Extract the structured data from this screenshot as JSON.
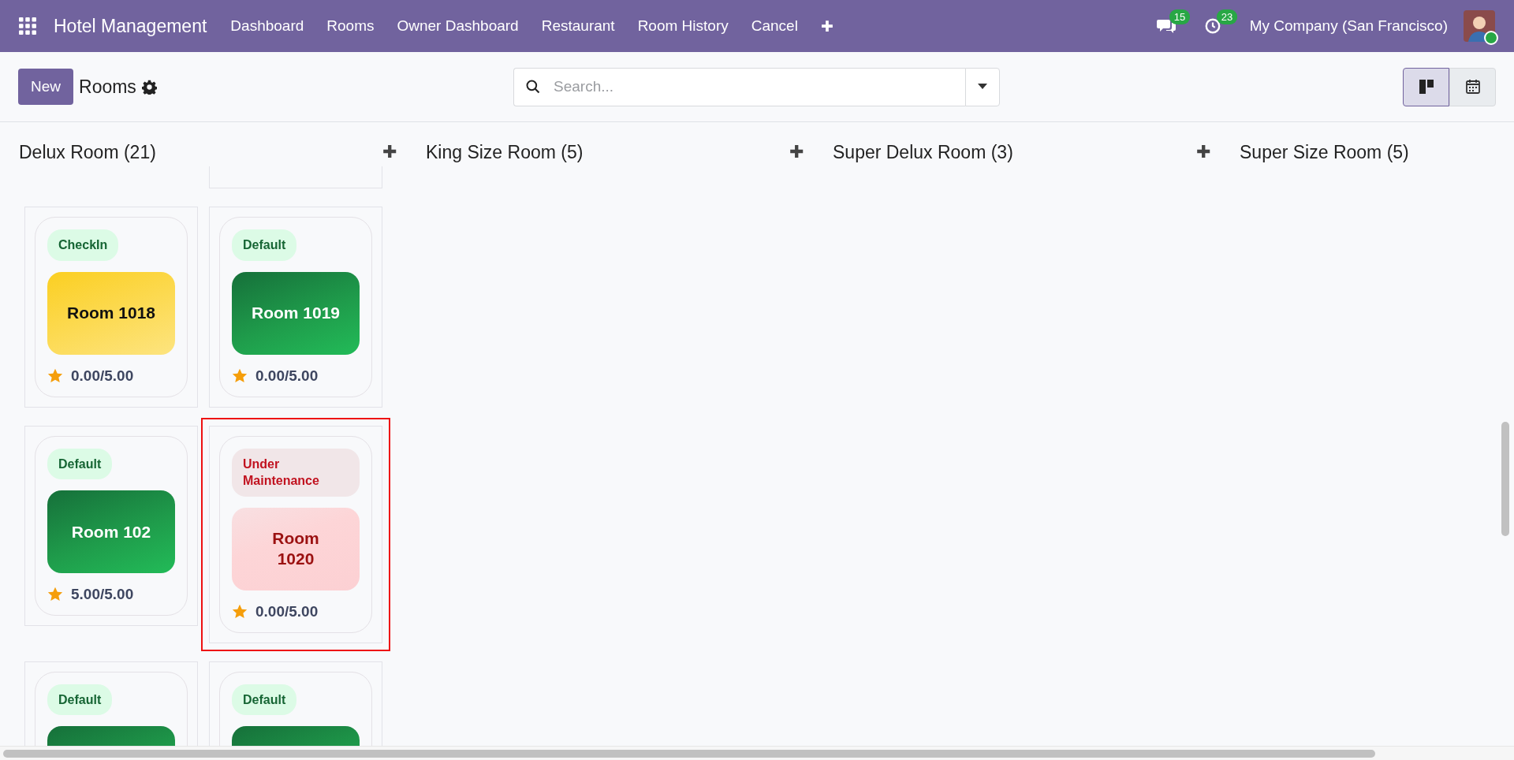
{
  "navbar": {
    "app_name": "Hotel Management",
    "menu": [
      "Dashboard",
      "Rooms",
      "Owner Dashboard",
      "Restaurant",
      "Room History",
      "Cancel"
    ],
    "add_symbol": "✚",
    "messages_badge": "15",
    "activities_badge": "23",
    "company": "My Company (San Francisco)"
  },
  "control_panel": {
    "new_button": "New",
    "title": "Rooms",
    "search": {
      "placeholder": "Search..."
    },
    "views": [
      {
        "kind": "kanban",
        "selected": true
      },
      {
        "kind": "calendar",
        "selected": false
      }
    ]
  },
  "columns": [
    {
      "title": "Delux Room (21)",
      "add_symbol": "✚",
      "cards": [
        {
          "kind": "checkin",
          "tag": "CheckIn",
          "name": "Room 1018",
          "rating": "0.00/5.00",
          "highlighted": false
        },
        {
          "kind": "default",
          "tag": "Default",
          "name": "Room 1019",
          "rating": "0.00/5.00",
          "highlighted": false
        },
        {
          "kind": "default",
          "tag": "Default",
          "name": "Room 102",
          "rating": "5.00/5.00",
          "highlighted": false
        },
        {
          "kind": "maintenance",
          "tag": "Under Maintenance",
          "name": "Room 1020",
          "rating": "0.00/5.00",
          "highlighted": true
        },
        {
          "kind": "default",
          "tag": "Default",
          "highlighted": false
        },
        {
          "kind": "default",
          "tag": "Default",
          "highlighted": false
        }
      ]
    },
    {
      "title": "King Size Room (5)",
      "add_symbol": "✚"
    },
    {
      "title": "Super Delux Room (3)",
      "add_symbol": "✚"
    },
    {
      "title": "Super Size Room (5)"
    }
  ]
}
